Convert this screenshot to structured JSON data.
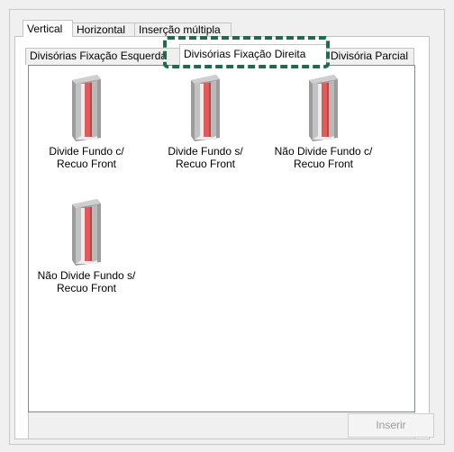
{
  "tabs_top": [
    "Vertical",
    "Horizontal",
    "Inserção múltipla"
  ],
  "tabs_sub": [
    "Divisórias Fixação Esquerda",
    "Divisórias Fixação Direita",
    "Divisória Parcial"
  ],
  "items": [
    {
      "line1": "Divide Fundo c/",
      "line2": "Recuo Front",
      "icon": "cabinet-divider-icon"
    },
    {
      "line1": "Divide Fundo s/",
      "line2": "Recuo Front",
      "icon": "cabinet-divider-icon"
    },
    {
      "line1": "Não Divide Fundo c/",
      "line2": "Recuo Front",
      "icon": "cabinet-divider-icon"
    },
    {
      "line1": "Não Divide Fundo s/",
      "line2": "Recuo Front",
      "icon": "cabinet-divider-icon"
    }
  ],
  "buttons": {
    "insert": "Inserir"
  },
  "colors": {
    "highlight": "#1f6b4d",
    "divider_red": "#e25b5b"
  }
}
